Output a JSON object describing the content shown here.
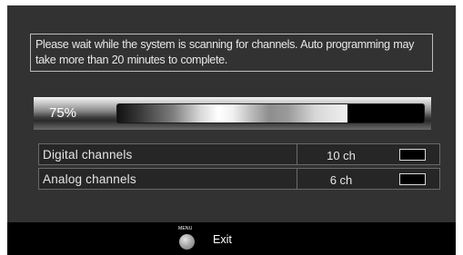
{
  "scan_screen": {
    "message": "Please wait while the system is scanning for channels. Auto programming may take more than 20 minutes to complete.",
    "progress": {
      "label": "75%",
      "value_percent": 75
    },
    "channels": [
      {
        "name": "Digital channels",
        "count": "10 ch"
      },
      {
        "name": "Analog channels",
        "count": "6 ch"
      }
    ],
    "footer": {
      "menu_button_caption": "MENU",
      "exit_label": "Exit"
    }
  },
  "colors": {
    "screen_background": "#323232",
    "footer_background": "#000000",
    "text": "#e6e6e6",
    "progress_track": "#000000"
  },
  "icons": {
    "menu_button": "menu-button-icon"
  }
}
